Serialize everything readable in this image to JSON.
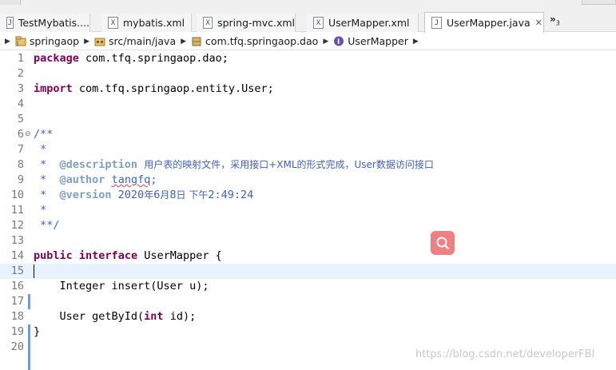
{
  "tabs": [
    {
      "label": "TestMybatis....",
      "icon": "java-file-icon",
      "active": false
    },
    {
      "label": "mybatis.xml",
      "icon": "xml-file-icon",
      "active": false
    },
    {
      "label": "spring-mvc.xml",
      "icon": "xml-file-icon",
      "active": false
    },
    {
      "label": "UserMapper.xml",
      "icon": "xml-file-icon",
      "active": false
    },
    {
      "label": "UserMapper.java",
      "icon": "java-file-icon",
      "active": true,
      "close": "✕"
    }
  ],
  "overflow": {
    "label": "»",
    "count": "3"
  },
  "breadcrumb": [
    {
      "label": "springaop",
      "icon": "project-icon"
    },
    {
      "label": "src/main/java",
      "icon": "source-folder-icon"
    },
    {
      "label": "com.tfq.springaop.dao",
      "icon": "package-icon"
    },
    {
      "label": "UserMapper",
      "icon": "interface-icon"
    }
  ],
  "editor": {
    "current_line": 15,
    "lines": [
      {
        "n": "1",
        "t": "package com.tfq.springaop.dao;"
      },
      {
        "n": "2",
        "t": ""
      },
      {
        "n": "3",
        "t": "import com.tfq.springaop.entity.User;"
      },
      {
        "n": "4",
        "t": ""
      },
      {
        "n": "5",
        "t": ""
      },
      {
        "n": "6",
        "t": "/**"
      },
      {
        "n": "7",
        "t": " *"
      },
      {
        "n": "8",
        "t": " *  @description 用户表的映射文件，采用接口+XML的形式完成，User数据访问接口"
      },
      {
        "n": "9",
        "t": " *  @author tangfq;"
      },
      {
        "n": "10",
        "t": " *  @version 2020年6月8日 下午2:49:24"
      },
      {
        "n": "11",
        "t": " *"
      },
      {
        "n": "12",
        "t": " **/"
      },
      {
        "n": "13",
        "t": ""
      },
      {
        "n": "14",
        "t": "public interface UserMapper {"
      },
      {
        "n": "15",
        "t": ""
      },
      {
        "n": "16",
        "t": "    Integer insert(User u);"
      },
      {
        "n": "17",
        "t": ""
      },
      {
        "n": "18",
        "t": "    User getById(int id);"
      },
      {
        "n": "19",
        "t": "}"
      },
      {
        "n": "20",
        "t": ""
      }
    ]
  },
  "watermark": "https://blog.csdn.net/developerFBI",
  "colors": {
    "keyword": "#7f0055",
    "comment": "#3f5fbf",
    "javadoc_tag": "#7f9fbf",
    "current_line": "#e8f2fe",
    "search_fab": "#f08080"
  }
}
